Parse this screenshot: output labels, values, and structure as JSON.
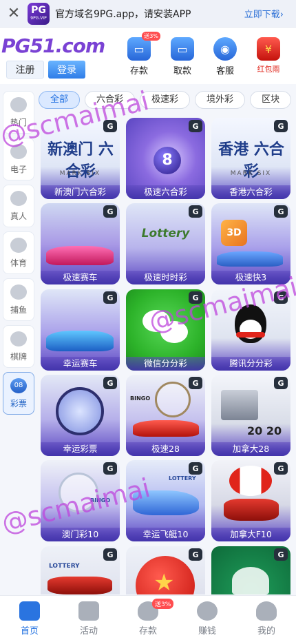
{
  "banner": {
    "close_glyph": "✕",
    "app_logo_big": "PG",
    "app_logo_small": "9PG.VIP",
    "text": "官方域名9PG.app，请安装APP",
    "download_label": "立即下载›"
  },
  "header": {
    "brand": "PG51.com",
    "register_label": "注册",
    "login_label": "登录",
    "actions": [
      {
        "label": "存款",
        "icon": "deposit-card-icon",
        "badge": "送3%"
      },
      {
        "label": "取款",
        "icon": "withdraw-card-icon",
        "badge": ""
      },
      {
        "label": "客服",
        "icon": "customer-service-icon",
        "badge": ""
      },
      {
        "label": "红包雨",
        "icon": "red-envelope-icon",
        "badge": ""
      }
    ]
  },
  "chips": [
    "全部",
    "六合彩",
    "极速彩",
    "境外彩",
    "区块"
  ],
  "sidebar": [
    {
      "label": "热门",
      "icon": "fire-icon"
    },
    {
      "label": "电子",
      "icon": "gamepad-icon"
    },
    {
      "label": "真人",
      "icon": "flame-icon"
    },
    {
      "label": "体育",
      "icon": "ball-icon"
    },
    {
      "label": "捕鱼",
      "icon": "fish-icon"
    },
    {
      "label": "棋牌",
      "icon": "cards-icon"
    },
    {
      "label": "彩票",
      "icon": "lottery-icon",
      "icon_text": "08"
    }
  ],
  "games": [
    {
      "name": "新澳门六合彩",
      "art": "新澳门 六合彩",
      "sub": "MARK SIX"
    },
    {
      "name": "极速六合彩",
      "art": "8",
      "sub": ""
    },
    {
      "name": "香港六合彩",
      "art": "香港 六合彩",
      "sub": "MARK SIX"
    },
    {
      "name": "极速赛车",
      "art": "",
      "sub": ""
    },
    {
      "name": "极速时时彩",
      "art": "Lottery",
      "sub": ""
    },
    {
      "name": "极速快3",
      "art": "3D",
      "sub": ""
    },
    {
      "name": "幸运赛车",
      "art": "",
      "sub": ""
    },
    {
      "name": "微信分分彩",
      "art": "",
      "sub": ""
    },
    {
      "name": "腾讯分分彩",
      "art": "",
      "sub": ""
    },
    {
      "name": "幸运彩票",
      "art": "",
      "sub": ""
    },
    {
      "name": "极速28",
      "art": "BINGO",
      "sub": ""
    },
    {
      "name": "加拿大28",
      "art": "20 20",
      "sub": ""
    },
    {
      "name": "澳门彩10",
      "art": "BINGO",
      "sub": ""
    },
    {
      "name": "幸运飞艇10",
      "art": "LOTTERY",
      "sub": ""
    },
    {
      "name": "加拿大F10",
      "art": "",
      "sub": ""
    },
    {
      "name": "",
      "art": "LOTTERY",
      "sub": ""
    },
    {
      "name": "",
      "art": "",
      "sub": ""
    },
    {
      "name": "",
      "art": "",
      "sub": ""
    }
  ],
  "game_badge": "G",
  "watermark": "@scmaimai",
  "bottom_nav": [
    {
      "label": "首页",
      "icon": "home-icon",
      "badge": ""
    },
    {
      "label": "活动",
      "icon": "gift-icon",
      "badge": ""
    },
    {
      "label": "存款",
      "icon": "money-bag-icon",
      "badge": "送3%"
    },
    {
      "label": "赚钱",
      "icon": "yuan-coin-icon",
      "badge": ""
    },
    {
      "label": "我的",
      "icon": "user-icon",
      "badge": ""
    }
  ],
  "colors": {
    "accent": "#2a74e0",
    "brand": "#7a42d4",
    "watermark": "#be46dc"
  }
}
